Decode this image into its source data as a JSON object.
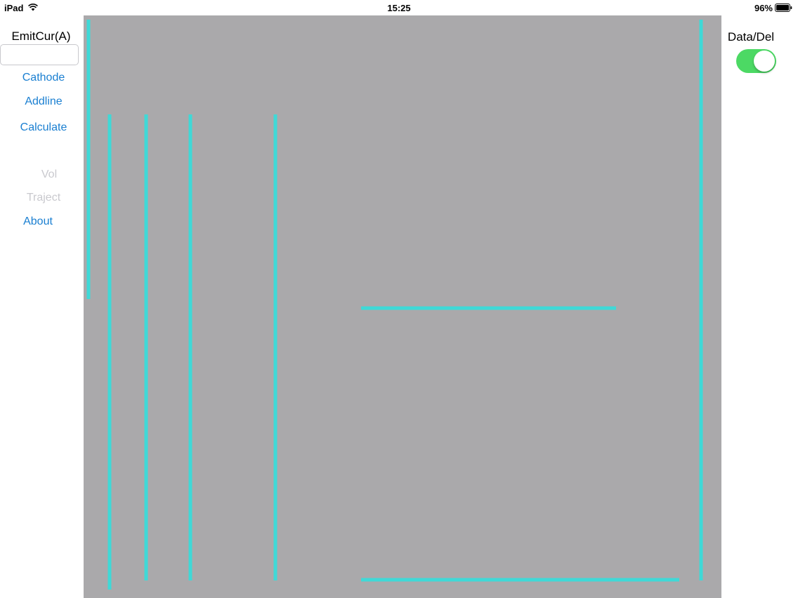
{
  "status_bar": {
    "device": "iPad",
    "time": "15:25",
    "battery": "96%",
    "icons": [
      "wifi-icon",
      "battery-icon"
    ]
  },
  "left_panel": {
    "emit_label": "EmitCur(A)",
    "emit_input": {
      "value": "",
      "placeholder": ""
    },
    "buttons": {
      "cathode": "Cathode",
      "addline": "Addline",
      "calculate": "Calculate",
      "vol": "Vol",
      "traject": "Traject",
      "about": "About"
    },
    "disabled": [
      "Vol",
      "Traject"
    ]
  },
  "right_panel": {
    "label": "Data/Del",
    "toggle_on": true
  },
  "colors": {
    "canvas_background": "#aaa9ab",
    "line": "#3fd9d7",
    "button_text": "#1a7fd1",
    "disabled_text": "#c9c9ce",
    "toggle_on": "#4cd964"
  }
}
